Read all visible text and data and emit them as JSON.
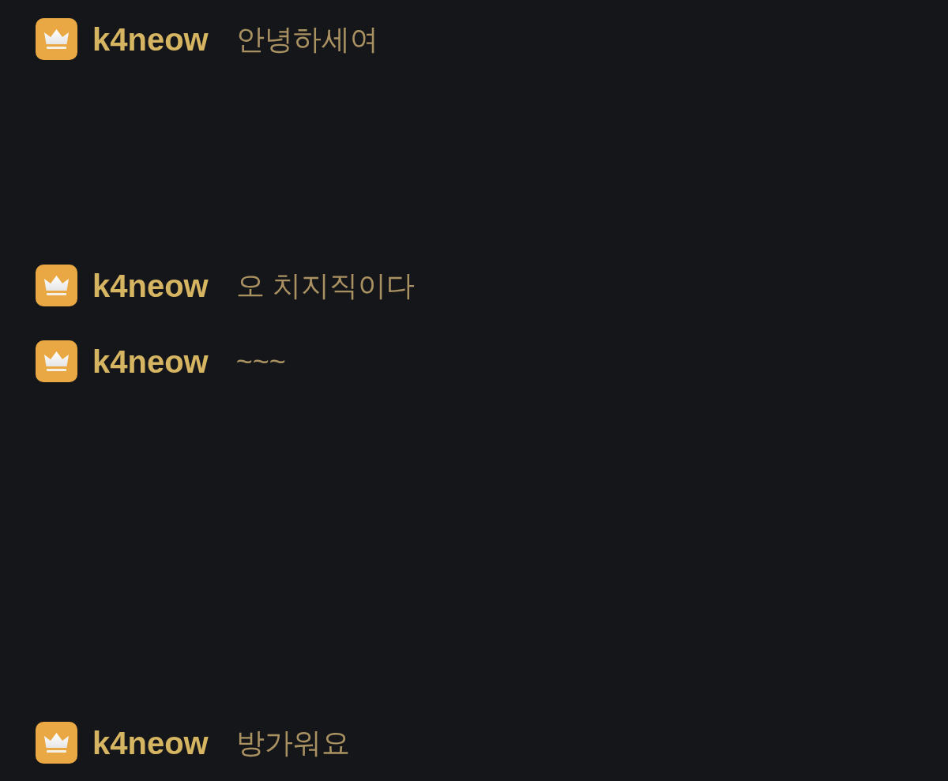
{
  "messages": [
    {
      "username": "k4neow",
      "text": "안녕하세여"
    },
    {
      "username": "k4neow",
      "text": "오 치지직이다"
    },
    {
      "username": "k4neow",
      "text": "~~~"
    },
    {
      "username": "k4neow",
      "text": "방가워요"
    }
  ]
}
